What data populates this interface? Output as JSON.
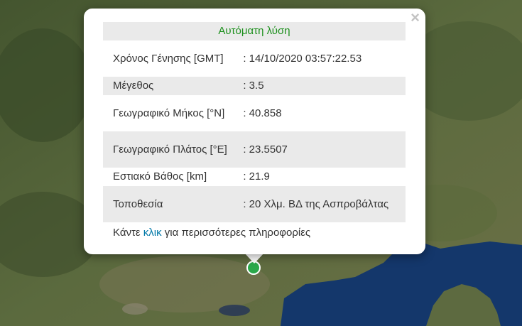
{
  "popup": {
    "title": "Αυτόματη λύση",
    "close_symbol": "×",
    "rows": [
      {
        "label": "Χρόνος Γένησης [GMT]",
        "value": ": 14/10/2020 03:57:22.53"
      },
      {
        "label": "Μέγεθος",
        "value": ": 3.5"
      },
      {
        "label": "Γεωγραφικό Μήκος [°N]",
        "value": ": 40.858"
      },
      {
        "label": "Γεωγραφικό Πλάτος [°E]",
        "value": ": 23.5507"
      },
      {
        "label": "Εστιακό Βάθος [km]",
        "value": ": 21.9"
      },
      {
        "label": "Τοποθεσία",
        "value": ": 20 Χλμ. ΒΔ της Ασπροβάλτας"
      }
    ],
    "more": {
      "prefix": "Κάντε ",
      "link": "κλικ",
      "suffix": " για περισσότερες πληροφορίες"
    }
  },
  "colors": {
    "title": "#1b8f1b",
    "link": "#0078a8",
    "marker": "#2aa84a",
    "sea": "#14376b"
  },
  "icons": {
    "close": "close-icon",
    "marker": "earthquake-marker-icon"
  }
}
